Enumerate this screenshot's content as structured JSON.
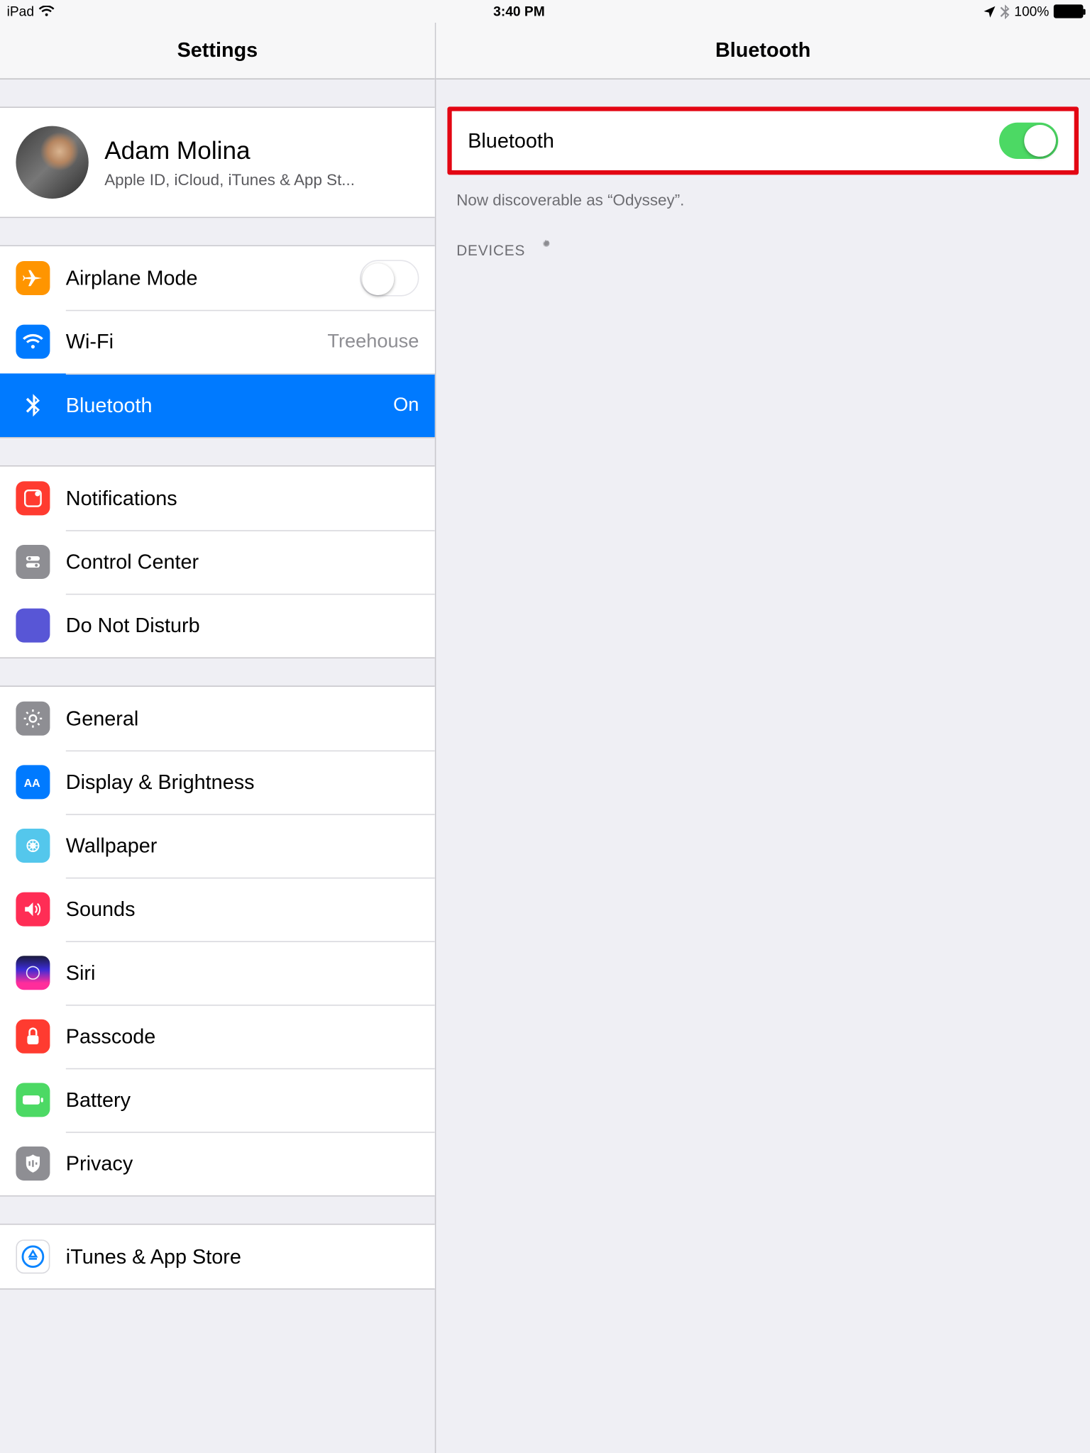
{
  "status": {
    "device": "iPad",
    "time": "3:40 PM",
    "battery_pct": "100%"
  },
  "master": {
    "title": "Settings",
    "profile": {
      "name": "Adam Molina",
      "subtitle": "Apple ID, iCloud, iTunes & App St..."
    },
    "network": {
      "airplane": {
        "label": "Airplane Mode"
      },
      "wifi": {
        "label": "Wi-Fi",
        "value": "Treehouse"
      },
      "bluetooth": {
        "label": "Bluetooth",
        "value": "On"
      }
    },
    "notifs": {
      "notifications": {
        "label": "Notifications"
      },
      "control_center": {
        "label": "Control Center"
      },
      "dnd": {
        "label": "Do Not Disturb"
      }
    },
    "general": {
      "general": {
        "label": "General"
      },
      "display": {
        "label": "Display & Brightness"
      },
      "wallpaper": {
        "label": "Wallpaper"
      },
      "sounds": {
        "label": "Sounds"
      },
      "siri": {
        "label": "Siri"
      },
      "passcode": {
        "label": "Passcode"
      },
      "battery": {
        "label": "Battery"
      },
      "privacy": {
        "label": "Privacy"
      }
    },
    "store": {
      "itunes": {
        "label": "iTunes & App Store"
      }
    }
  },
  "detail": {
    "title": "Bluetooth",
    "toggle": {
      "label": "Bluetooth",
      "on": true
    },
    "discoverable_text": "Now discoverable as “Odyssey”.",
    "devices_header": "DEVICES"
  },
  "colors": {
    "accent": "#007aff",
    "switch_on": "#4cd964",
    "highlight_border": "#e30613"
  }
}
